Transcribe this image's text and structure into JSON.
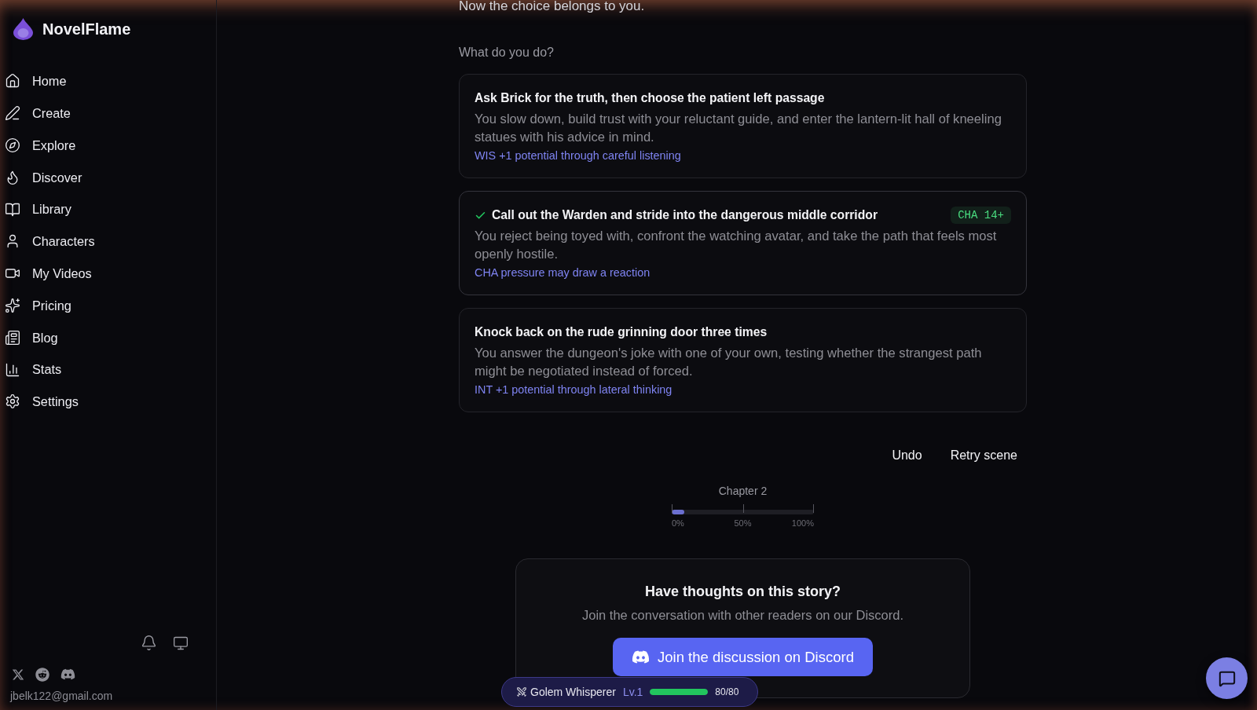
{
  "sidebar": {
    "brand": "NovelFlame",
    "nav": [
      "Home",
      "Create",
      "Explore",
      "Discover",
      "Library",
      "Characters",
      "My Videos",
      "Pricing",
      "Blog",
      "Stats",
      "Settings"
    ],
    "email": "jbelk122@gmail.com"
  },
  "story": {
    "lead_in": "Now the choice belongs to you.",
    "prompt": "What do you do?",
    "choices": [
      {
        "title": "Ask Brick for the truth, then choose the patient left passage",
        "description": "You slow down, build trust with your reluctant guide, and enter the lantern-lit hall of kneeling statues with his advice in mind.",
        "hint": "WIS +1 potential through careful listening",
        "selected": false
      },
      {
        "title": "Call out the Warden and stride into the dangerous middle corridor",
        "description": "You reject being toyed with, confront the watching avatar, and take the path that feels most openly hostile.",
        "hint": "CHA pressure may draw a reaction",
        "requirement": "CHA 14+",
        "selected": true
      },
      {
        "title": "Knock back on the rude grinning door three times",
        "description": "You answer the dungeon's joke with one of your own, testing whether the strangest path might be negotiated instead of forced.",
        "hint": "INT +1 potential through lateral thinking",
        "selected": false
      }
    ],
    "actions": [
      "Undo",
      "Retry scene"
    ],
    "chapter": {
      "label": "Chapter 2",
      "level": 0.09,
      "ticks": [
        "0%",
        "50%",
        "100%"
      ]
    }
  },
  "discord_card": {
    "title": "Have thoughts on this story?",
    "subtitle": "Join the conversation with other readers on our Discord.",
    "button": "Join the discussion on Discord"
  },
  "achievement_badge": {
    "title": "Golem Whisperer",
    "level_label": "Lv.1",
    "level": 1,
    "reading": "80/80"
  }
}
